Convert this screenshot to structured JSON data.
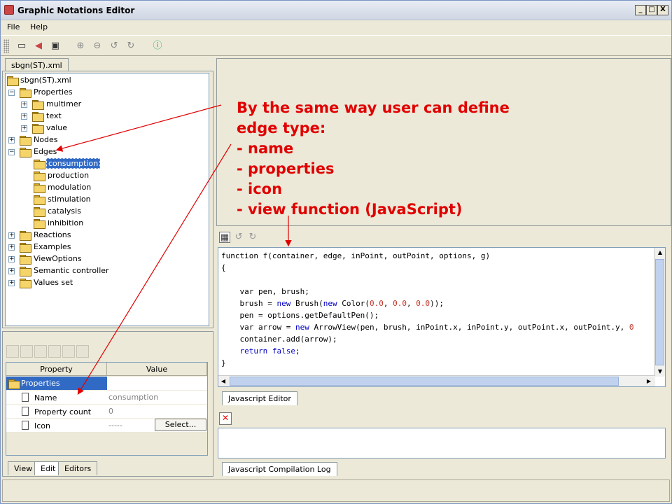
{
  "window": {
    "title": "Graphic Notations Editor",
    "minimize": "_",
    "maximize": "□",
    "close": "X"
  },
  "menu": {
    "file": "File",
    "help": "Help"
  },
  "left_tab": "sbgn(ST).xml",
  "tree": {
    "root": "sbgn(ST).xml",
    "properties": "Properties",
    "multimer": "multimer",
    "text": "text",
    "value": "value",
    "nodes": "Nodes",
    "edges": "Edges",
    "edge_items": [
      "consumption",
      "production",
      "modulation",
      "stimulation",
      "catalysis",
      "inhibition"
    ],
    "reactions": "Reactions",
    "examples": "Examples",
    "viewoptions": "ViewOptions",
    "semantic": "Semantic controller",
    "valuesset": "Values set"
  },
  "annotation": {
    "line1": "By the same way user can define",
    "line2": "edge type:",
    "line3": "- name",
    "line4": "- properties",
    "line5": "- icon",
    "line6": "- view function (JavaScript)"
  },
  "code": {
    "l1a": "function f(container, edge, inPoint, outPoint, options, g)",
    "l2": "{",
    "l4": "var pen, brush;",
    "l5a": "brush = ",
    "l5b": "new",
    "l5c": " Brush(",
    "l5d": "new",
    "l5e": " Color(",
    "l5f": "0.0",
    "l5g": ", ",
    "l5h": "0.0",
    "l5i": ", ",
    "l5j": "0.0",
    "l5k": "));",
    "l6": "pen = options.getDefaultPen();",
    "l7a": "var arrow = ",
    "l7b": "new",
    "l7c": " ArrowView(pen, brush, inPoint.x, inPoint.y, outPoint.x, outPoint.y, ",
    "l7d": "0",
    "l8": "container.add(arrow);",
    "l9a": "return ",
    "l9b": "false",
    "l9c": ";",
    "l10": "}"
  },
  "tabs": {
    "js_editor": "Javascript Editor",
    "js_log": "Javascript Compilation Log",
    "view": "View",
    "edit": "Edit",
    "editors": "Editors"
  },
  "properties": {
    "col_property": "Property",
    "col_value": "Value",
    "group": "Properties",
    "rows": [
      {
        "name": "Name",
        "value": "consumption"
      },
      {
        "name": "Property count",
        "value": "0"
      },
      {
        "name": "Icon",
        "value": "-----"
      }
    ],
    "select_button": "Select..."
  },
  "colors": {
    "annotation": "#e00000",
    "selection": "#316ac5"
  }
}
